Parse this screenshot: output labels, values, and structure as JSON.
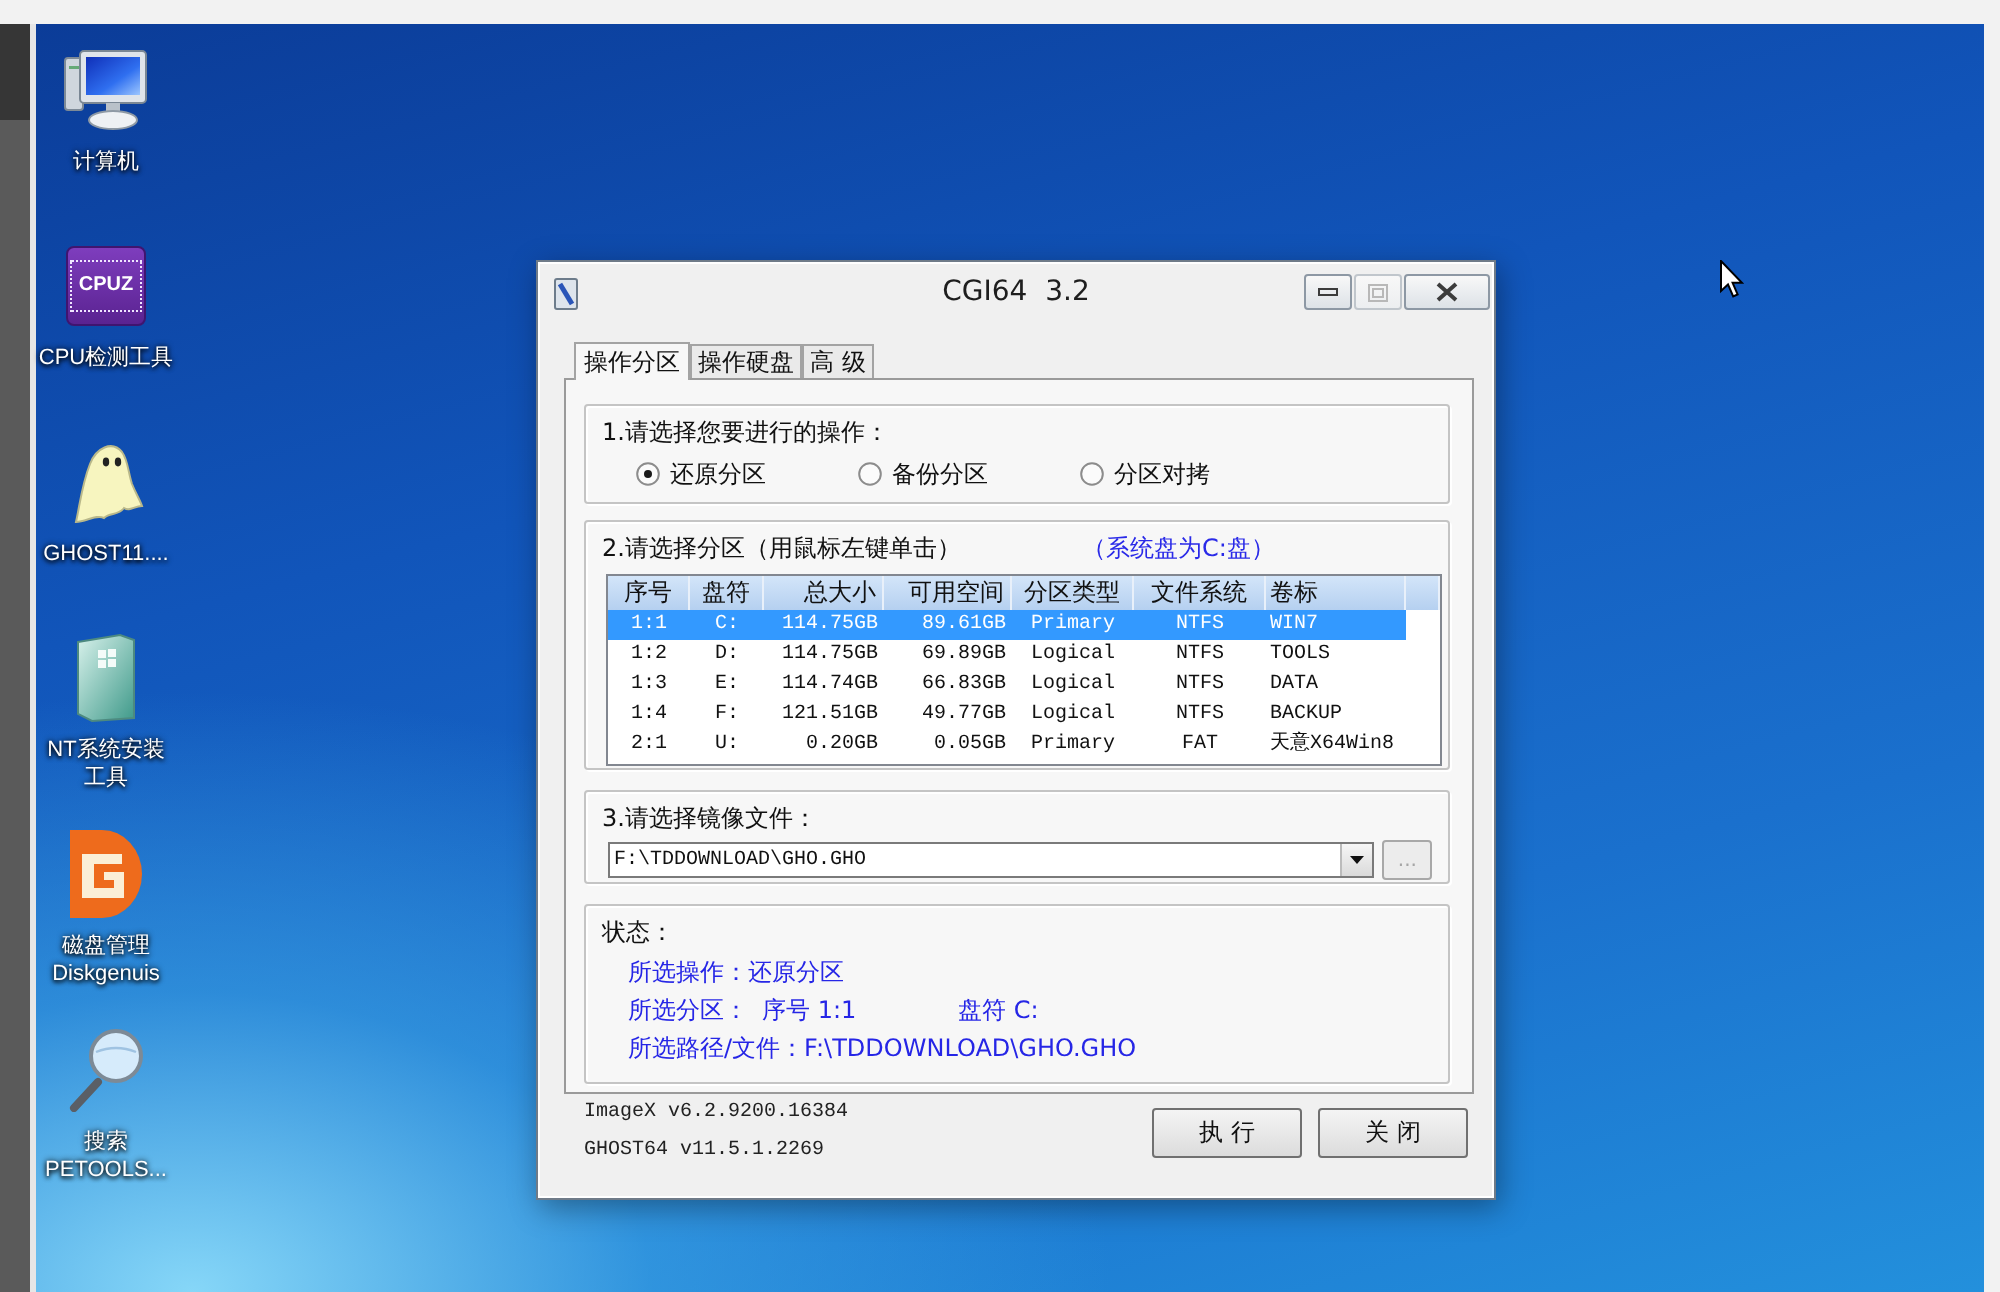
{
  "desktop": {
    "icons": [
      {
        "kind": "computer",
        "label": "计算机"
      },
      {
        "kind": "cpu",
        "logo": "CPUZ",
        "label": "CPU检测工具"
      },
      {
        "kind": "ghost",
        "label": "GHOST11...."
      },
      {
        "kind": "installer",
        "label": "NT系统安装工具"
      },
      {
        "kind": "diskgenius",
        "label": "磁盘管理 Diskgenuis"
      },
      {
        "kind": "search",
        "label": "搜索 PETOOLS..."
      }
    ]
  },
  "window": {
    "title": "CGI64  3.2",
    "controls": [
      {
        "kind": "minimize",
        "disabled": false
      },
      {
        "kind": "maximize",
        "disabled": true
      },
      {
        "kind": "close",
        "disabled": false
      }
    ],
    "tabs": [
      {
        "label": "操作分区",
        "selected": true
      },
      {
        "label": "操作硬盘",
        "selected": false
      },
      {
        "label": "高 级",
        "selected": false
      }
    ],
    "operation": {
      "label": "1.请选择您要进行的操作：",
      "options": [
        {
          "label": "还原分区",
          "selected": true
        },
        {
          "label": "备份分区",
          "selected": false
        },
        {
          "label": "分区对拷",
          "selected": false
        }
      ]
    },
    "partition": {
      "label": "2.请选择分区（用鼠标左键单击）",
      "note": "（系统盘为C:盘）",
      "table": {
        "columns": [
          "序号",
          "盘符",
          "总大小",
          "可用空间",
          "分区类型",
          "文件系统",
          "卷标"
        ],
        "rows": [
          {
            "selected": true,
            "cells": [
              "1:1",
              "C:",
              "114.75GB",
              "89.61GB",
              "Primary",
              "NTFS",
              "WIN7"
            ]
          },
          {
            "selected": false,
            "cells": [
              "1:2",
              "D:",
              "114.75GB",
              "69.89GB",
              "Logical",
              "NTFS",
              "TOOLS"
            ]
          },
          {
            "selected": false,
            "cells": [
              "1:3",
              "E:",
              "114.74GB",
              "66.83GB",
              "Logical",
              "NTFS",
              "DATA"
            ]
          },
          {
            "selected": false,
            "cells": [
              "1:4",
              "F:",
              "121.51GB",
              "49.77GB",
              "Logical",
              "NTFS",
              "BACKUP"
            ]
          },
          {
            "selected": false,
            "cells": [
              "2:1",
              "U:",
              "0.20GB",
              "0.05GB",
              "Primary",
              "FAT",
              "天意X64Win8"
            ]
          }
        ]
      }
    },
    "image_file": {
      "label": "3.请选择镜像文件：",
      "value": "F:\\TDDOWNLOAD\\GHO.GHO",
      "browse": {
        "label": "...",
        "disabled": true
      }
    },
    "status": {
      "label": "状态：",
      "lines": [
        [
          "所选操作：还原分区"
        ],
        [
          "所选分区：",
          "序号 1:1",
          "盘符 C:"
        ],
        [
          "所选路径/文件：F:\\TDDOWNLOAD\\GHO.GHO"
        ]
      ]
    },
    "versions": [
      "ImageX v6.2.9200.16384",
      "GHOST64 v11.5.1.2269"
    ],
    "buttons": [
      "执 行",
      "关 闭"
    ]
  }
}
